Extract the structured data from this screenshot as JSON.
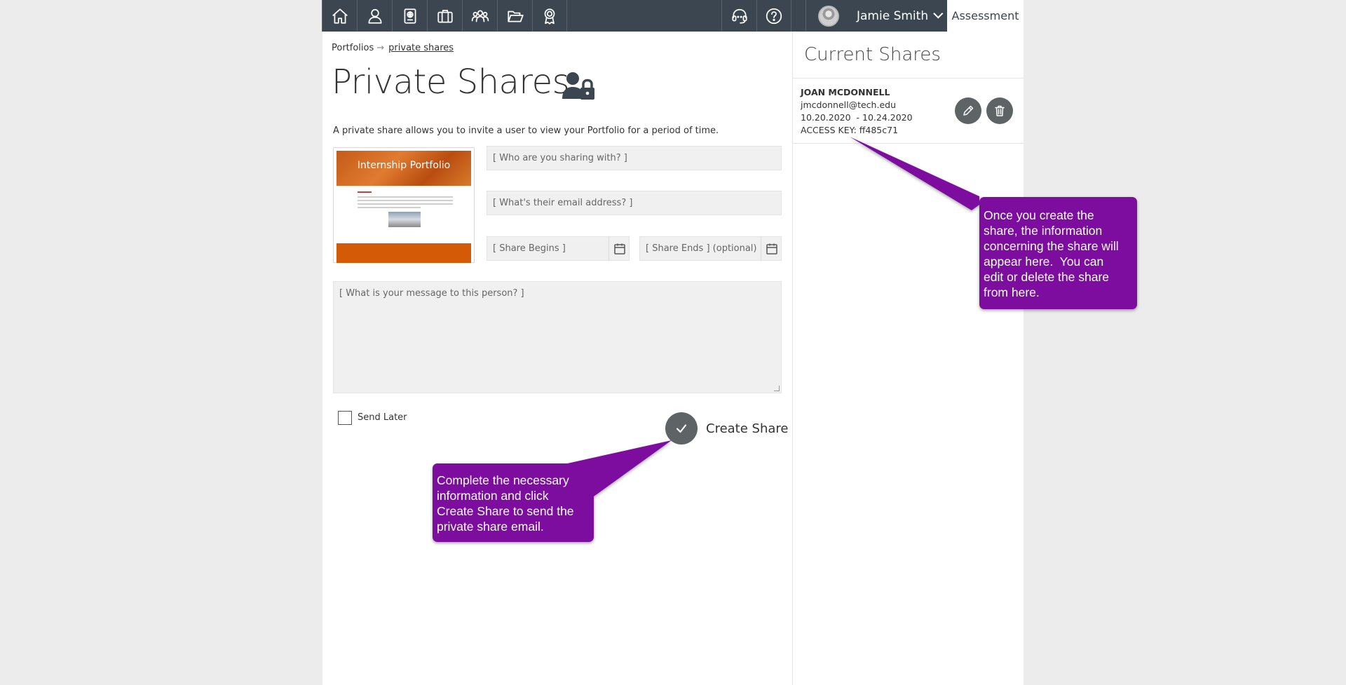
{
  "header": {
    "nav_icons": [
      "home-icon",
      "user-icon",
      "passport-icon",
      "briefcase-icon",
      "group-icon",
      "folder-open-icon",
      "award-icon"
    ],
    "support_icon": "headset-icon",
    "help_icon": "help-icon",
    "user_name": "Jamie Smith",
    "assessment_label": "Assessment"
  },
  "breadcrumb": {
    "root": "Portfolios",
    "separator": "→",
    "current": "private shares"
  },
  "page": {
    "title": "Private Shares",
    "description": "A private share allows you to invite a user to view your Portfolio for a period of time.",
    "thumbnail_title": "Internship Portfolio"
  },
  "form": {
    "who_placeholder": "[ Who are you sharing with? ]",
    "email_placeholder": "[ What's their email address? ]",
    "begins_placeholder": "[ Share Begins ]",
    "ends_placeholder": "[ Share Ends ] (optional)",
    "message_placeholder": "[ What is your message to this person? ]",
    "send_later_label": "Send Later",
    "create_label": "Create Share"
  },
  "current_shares": {
    "title": "Current Shares",
    "items": [
      {
        "name": "JOAN MCDONNELL",
        "email": "jmcdonnell@tech.edu",
        "dates": "10.20.2020  - 10.24.2020",
        "access_key": "ACCESS KEY: ff485c71"
      }
    ]
  },
  "callouts": {
    "right": [
      "Once you create the",
      "share, the information",
      "concerning the share will",
      "appear here.  You can",
      "edit or delete the share",
      "from here."
    ],
    "bottom": [
      "Complete the necessary",
      "information and click",
      "Create Share to send the",
      "private share email."
    ],
    "color": "#7b0e9e"
  }
}
